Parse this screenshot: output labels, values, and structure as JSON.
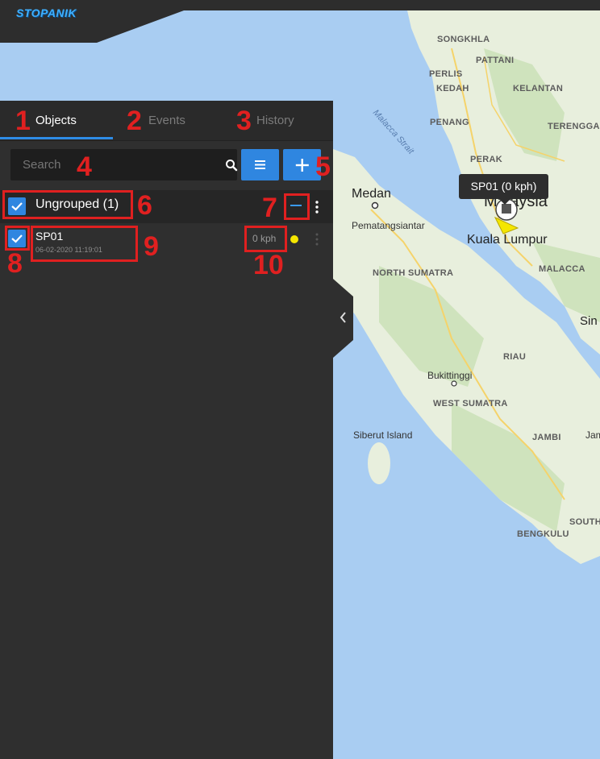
{
  "app": {
    "logo_text": "STOPANIK"
  },
  "tabs": [
    {
      "label": "Objects",
      "number": "1",
      "active": true
    },
    {
      "label": "Events",
      "number": "2",
      "active": false
    },
    {
      "label": "History",
      "number": "3",
      "active": false
    }
  ],
  "search": {
    "placeholder": "Search",
    "number": "4"
  },
  "toolbar": {
    "add_number": "5"
  },
  "group": {
    "label": "Ungrouped (1)",
    "number": "6",
    "collapse_number": "7",
    "checked": true
  },
  "object": {
    "name": "SP01",
    "timestamp": "06-02-2020 11:19:01",
    "speed": "0 kph",
    "checkbox_number": "8",
    "info_number": "9",
    "speed_number": "10",
    "status_color": "#f5e600",
    "checked": true
  },
  "map": {
    "tooltip": "SP01 (0 kph)",
    "regions": [
      "SONGKHLA",
      "PATTANI",
      "PERLIS",
      "KEDAH",
      "KELANTAN",
      "PENANG",
      "TERENGGANU",
      "PERAK",
      "NORTH SUMATRA",
      "MALACCA",
      "RIAU",
      "WEST SUMATRA",
      "JAMBI",
      "SOUTH",
      "BENGKULU"
    ],
    "cities": [
      "Medan",
      "Kuala Lumpur",
      "Malaysia"
    ],
    "towns": [
      "Pematangsiantar",
      "Bukittinggi",
      "Siberut Island",
      "Sin",
      "Jam"
    ],
    "sea": "Malacca Strait"
  },
  "colors": {
    "accent": "#2f86e0",
    "annotation": "#e02020",
    "panel_bg": "#2f2f2f",
    "water": "#a9cdf2",
    "land": "#e8efdd"
  },
  "icons": {
    "search": "search-icon",
    "list": "list-icon",
    "add": "plus-icon",
    "collapse": "minus-icon",
    "menu": "kebab-icon",
    "collapse_panel": "chevron-left-icon",
    "vehicle": "vehicle-marker-icon"
  }
}
